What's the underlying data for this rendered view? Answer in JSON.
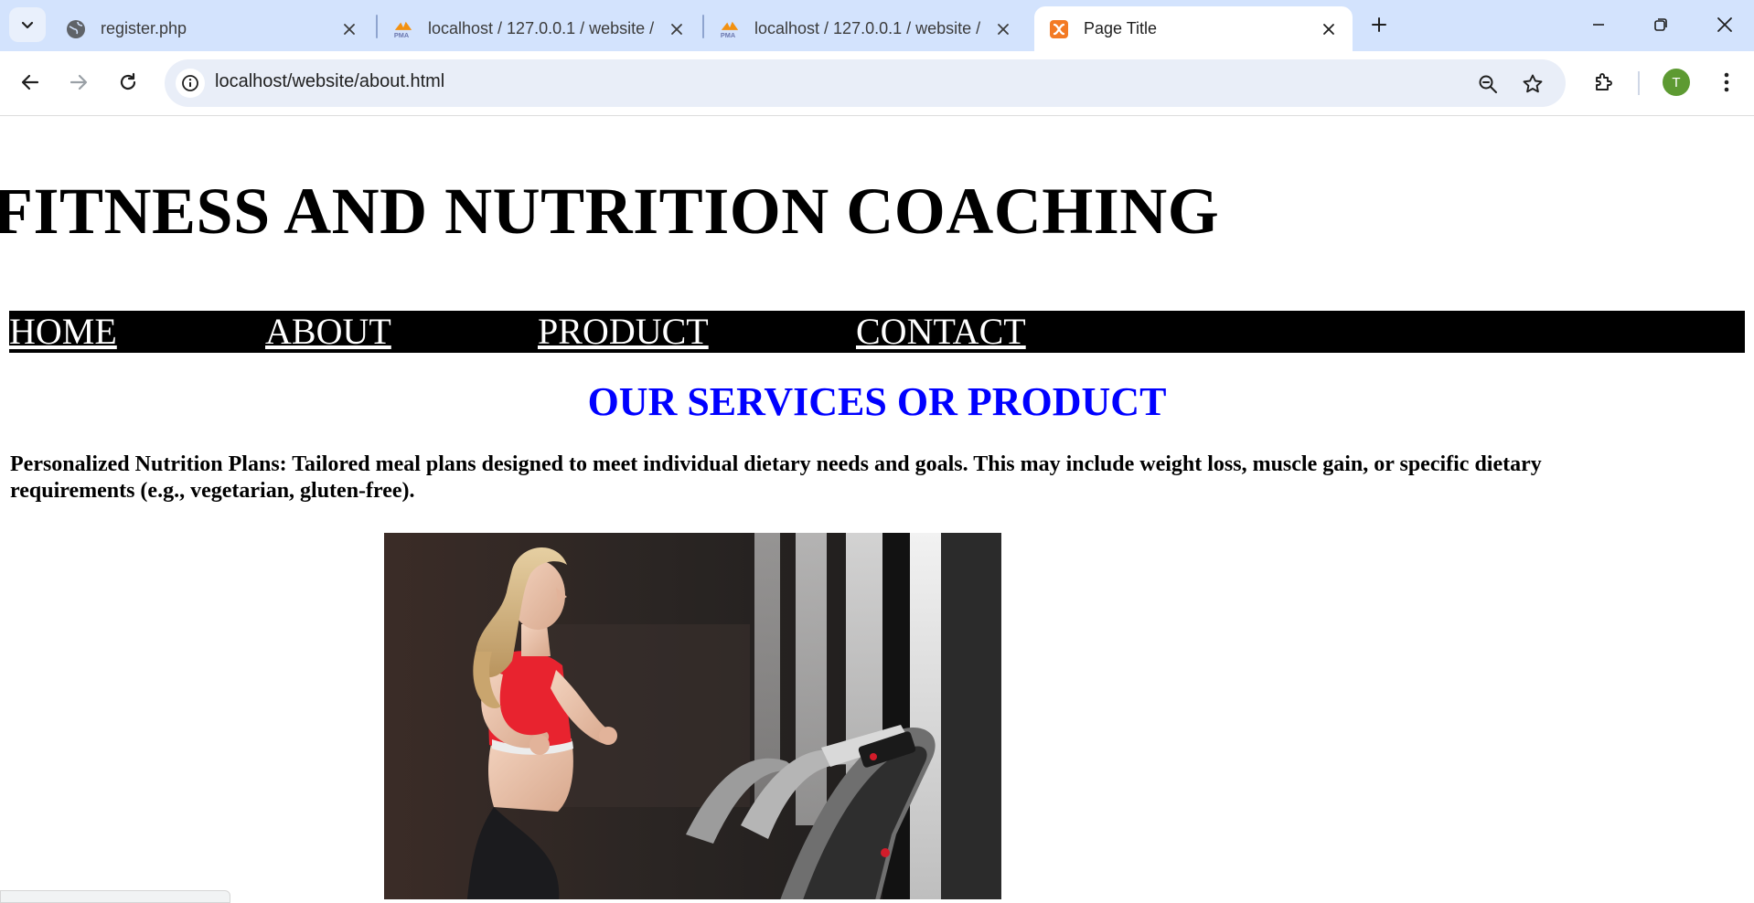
{
  "browser": {
    "tabs": [
      {
        "title": "register.php",
        "favicon": "globe-icon",
        "active": false
      },
      {
        "title": "localhost / 127.0.0.1 / website /",
        "favicon": "phpmyadmin-icon",
        "active": false
      },
      {
        "title": "localhost / 127.0.0.1 / website /",
        "favicon": "phpmyadmin-icon",
        "active": false
      },
      {
        "title": "Page Title",
        "favicon": "xampp-icon",
        "active": true
      }
    ],
    "address": "localhost/website/about.html",
    "profile_initial": "T",
    "colors": {
      "tabstrip": "#d3e3fd",
      "omnibox": "#e9eef8",
      "avatar": "#5d9a32"
    }
  },
  "site": {
    "title": "FITNESS AND NUTRITION COACHING",
    "nav": [
      "HOME",
      "ABOUT",
      "PRODUCT",
      "CONTACT"
    ],
    "section_heading": "OUR SERVICES OR PRODUCT",
    "service_text": "Personalized Nutrition Plans: Tailored meal plans designed to meet individual dietary needs and goals. This may include weight loss, muscle gain, or specific dietary requirements (e.g., vegetarian, gluten-free).",
    "colors": {
      "heading": "#0000ff",
      "nav_bg": "#000000",
      "nav_text": "#ffffff"
    }
  }
}
